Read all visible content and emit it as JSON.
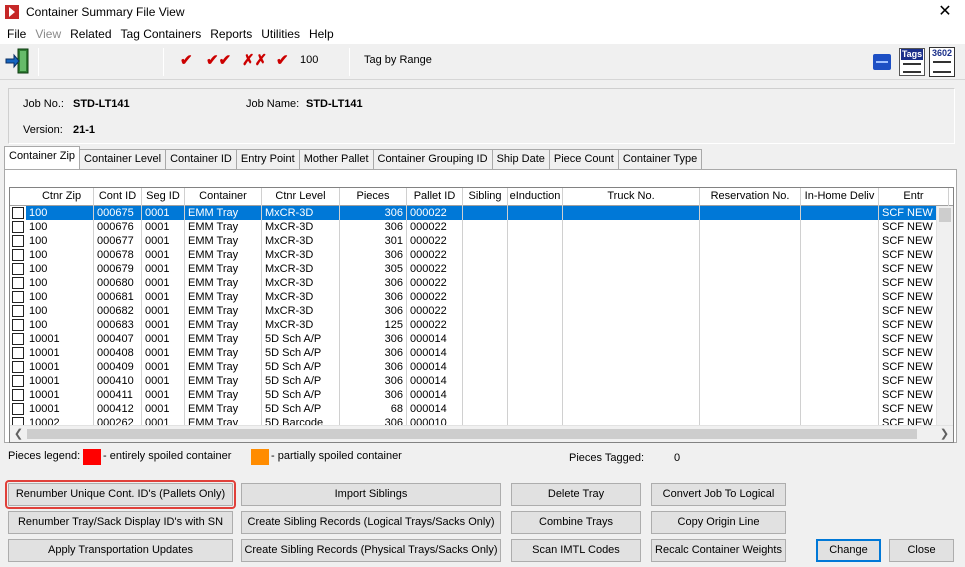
{
  "window": {
    "title": "Container Summary File View"
  },
  "menu": [
    "File",
    "View",
    "Related",
    "Tag Containers",
    "Reports",
    "Utilities",
    "Help"
  ],
  "toolbar": {
    "count": "100",
    "tag_by_range": "Tag by Range",
    "tags_label": "Tags",
    "form_label": "3602"
  },
  "job": {
    "job_no_label": "Job No.:",
    "job_no": "STD-LT141",
    "job_name_label": "Job Name:",
    "job_name": "STD-LT141",
    "version_label": "Version:",
    "version": "21-1"
  },
  "tabs": [
    "Container Zip",
    "Container Level",
    "Container ID",
    "Entry Point",
    "Mother Pallet",
    "Container Grouping ID",
    "Ship Date",
    "Piece Count",
    "Container Type"
  ],
  "grid": {
    "columns": [
      "Ctnr Zip",
      "Cont ID",
      "Seg ID",
      "Container",
      "Ctnr Level",
      "Pieces",
      "Pallet ID",
      "Sibling",
      "eInduction",
      "Truck No.",
      "Reservation No.",
      "In-Home Deliv",
      "Entr"
    ],
    "rows": [
      [
        "100",
        "000675",
        "0001",
        "EMM Tray",
        "MxCR-3D",
        "306",
        "000022",
        "",
        "",
        "",
        "",
        "",
        "SCF NEW YO"
      ],
      [
        "100",
        "000676",
        "0001",
        "EMM Tray",
        "MxCR-3D",
        "306",
        "000022",
        "",
        "",
        "",
        "",
        "",
        "SCF NEW YO"
      ],
      [
        "100",
        "000677",
        "0001",
        "EMM Tray",
        "MxCR-3D",
        "301",
        "000022",
        "",
        "",
        "",
        "",
        "",
        "SCF NEW YO"
      ],
      [
        "100",
        "000678",
        "0001",
        "EMM Tray",
        "MxCR-3D",
        "306",
        "000022",
        "",
        "",
        "",
        "",
        "",
        "SCF NEW YO"
      ],
      [
        "100",
        "000679",
        "0001",
        "EMM Tray",
        "MxCR-3D",
        "305",
        "000022",
        "",
        "",
        "",
        "",
        "",
        "SCF NEW YO"
      ],
      [
        "100",
        "000680",
        "0001",
        "EMM Tray",
        "MxCR-3D",
        "306",
        "000022",
        "",
        "",
        "",
        "",
        "",
        "SCF NEW YO"
      ],
      [
        "100",
        "000681",
        "0001",
        "EMM Tray",
        "MxCR-3D",
        "306",
        "000022",
        "",
        "",
        "",
        "",
        "",
        "SCF NEW YO"
      ],
      [
        "100",
        "000682",
        "0001",
        "EMM Tray",
        "MxCR-3D",
        "306",
        "000022",
        "",
        "",
        "",
        "",
        "",
        "SCF NEW YO"
      ],
      [
        "100",
        "000683",
        "0001",
        "EMM Tray",
        "MxCR-3D",
        "125",
        "000022",
        "",
        "",
        "",
        "",
        "",
        "SCF NEW YO"
      ],
      [
        "10001",
        "000407",
        "0001",
        "EMM Tray",
        "5D Sch A/P",
        "306",
        "000014",
        "",
        "",
        "",
        "",
        "",
        "SCF NEW YO"
      ],
      [
        "10001",
        "000408",
        "0001",
        "EMM Tray",
        "5D Sch A/P",
        "306",
        "000014",
        "",
        "",
        "",
        "",
        "",
        "SCF NEW YO"
      ],
      [
        "10001",
        "000409",
        "0001",
        "EMM Tray",
        "5D Sch A/P",
        "306",
        "000014",
        "",
        "",
        "",
        "",
        "",
        "SCF NEW YO"
      ],
      [
        "10001",
        "000410",
        "0001",
        "EMM Tray",
        "5D Sch A/P",
        "306",
        "000014",
        "",
        "",
        "",
        "",
        "",
        "SCF NEW YO"
      ],
      [
        "10001",
        "000411",
        "0001",
        "EMM Tray",
        "5D Sch A/P",
        "306",
        "000014",
        "",
        "",
        "",
        "",
        "",
        "SCF NEW YO"
      ],
      [
        "10001",
        "000412",
        "0001",
        "EMM Tray",
        "5D Sch A/P",
        "68",
        "000014",
        "",
        "",
        "",
        "",
        "",
        "SCF NEW YO"
      ],
      [
        "10002",
        "000262",
        "0001",
        "EMM Tray",
        "5D Barcode",
        "306",
        "000010",
        "",
        "",
        "",
        "",
        "",
        "SCF NEW YO"
      ]
    ],
    "selected_row": 0
  },
  "legend": {
    "title": "Pieces legend:",
    "entire": "- entirely spoiled container",
    "partial": "- partially spoiled container",
    "tagged_label": "Pieces Tagged:",
    "tagged_value": "0",
    "colors": {
      "entire": "#ff0000",
      "partial": "#ff8c00"
    }
  },
  "buttons": {
    "renumber_unique": "Renumber Unique Cont. ID's (Pallets Only)",
    "renumber_tray": "Renumber Tray/Sack Display ID's with SN",
    "apply_transport": "Apply Transportation Updates",
    "import_siblings": "Import Siblings",
    "create_logical": "Create Sibling Records (Logical Trays/Sacks Only)",
    "create_physical": "Create Sibling Records (Physical Trays/Sacks Only)",
    "delete_tray": "Delete Tray",
    "combine_trays": "Combine Trays",
    "scan_imtl": "Scan IMTL Codes",
    "convert_logical": "Convert Job To Logical",
    "copy_origin": "Copy Origin Line",
    "recalc_weights": "Recalc Container Weights",
    "change": "Change",
    "close": "Close"
  },
  "colors": {
    "selection": "#0078d7",
    "highlight_outline": "#e0403a"
  }
}
